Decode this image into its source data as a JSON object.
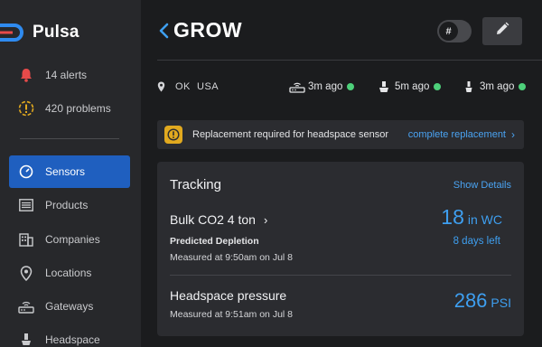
{
  "brand": {
    "name": "Pulsa",
    "accent": "#2f8bf0",
    "logo_accent": "#e64a4a"
  },
  "sidebar": {
    "alerts": {
      "label": "14 alerts",
      "icon": "bell-icon",
      "color": "#e64a4a"
    },
    "problems": {
      "label": "420 problems",
      "icon": "warning-circle-icon",
      "color": "#e1a91f"
    },
    "items": [
      {
        "label": "Sensors",
        "icon": "gauge-icon",
        "active": true
      },
      {
        "label": "Products",
        "icon": "list-icon"
      },
      {
        "label": "Companies",
        "icon": "building-icon"
      },
      {
        "label": "Locations",
        "icon": "location-pin-icon"
      },
      {
        "label": "Gateways",
        "icon": "router-icon"
      },
      {
        "label": "Headspace",
        "icon": "sensor-icon"
      }
    ]
  },
  "header": {
    "title": "GROW",
    "toggle_symbol": "#",
    "edit_icon": "pencil-icon"
  },
  "location": {
    "text": "OK  USA"
  },
  "stats": [
    {
      "icon": "gateway-icon",
      "value": "3m ago",
      "status_color": "#4dd07a"
    },
    {
      "icon": "sensor-icon",
      "value": "5m ago",
      "status_color": "#4dd07a"
    },
    {
      "icon": "sensor-small-icon",
      "value": "3m ago",
      "status_color": "#4dd07a"
    }
  ],
  "alert": {
    "message": "Replacement required for headspace sensor",
    "action": "complete replacement",
    "icon_color": "#e1a91f"
  },
  "tracking": {
    "title": "Tracking",
    "link": "Show Details",
    "item1": {
      "name": "Bulk CO2 4 ton",
      "subtitle": "Predicted Depletion",
      "measured": "Measured at 9:50am on Jul 8",
      "value": "18",
      "unit": "in WC",
      "days_left": "8 days left"
    },
    "item2": {
      "name": "Headspace pressure",
      "measured": "Measured at 9:51am on Jul 8",
      "value": "286",
      "unit": "PSI"
    }
  }
}
